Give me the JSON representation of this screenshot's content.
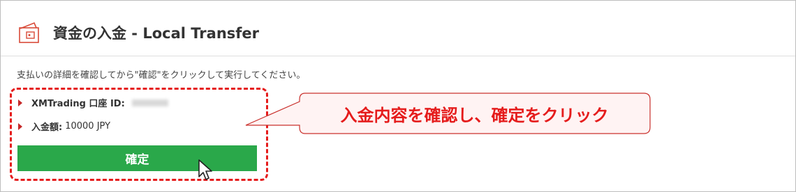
{
  "header": {
    "title": "資金の入金 - Local Transfer",
    "icon": "wallet-icon"
  },
  "instruction": "支払いの詳細を確認してから\"確認\"をクリックして実行してください。",
  "details": {
    "account_label": "XMTrading 口座 ID:",
    "amount_label": "入金額:",
    "amount_value": "10000 JPY"
  },
  "confirm_button_label": "確定",
  "annotation": {
    "callout_text": "入金内容を確認し、確定をクリック"
  },
  "colors": {
    "accent_red": "#e51c1c",
    "button_green": "#2aa84a"
  }
}
